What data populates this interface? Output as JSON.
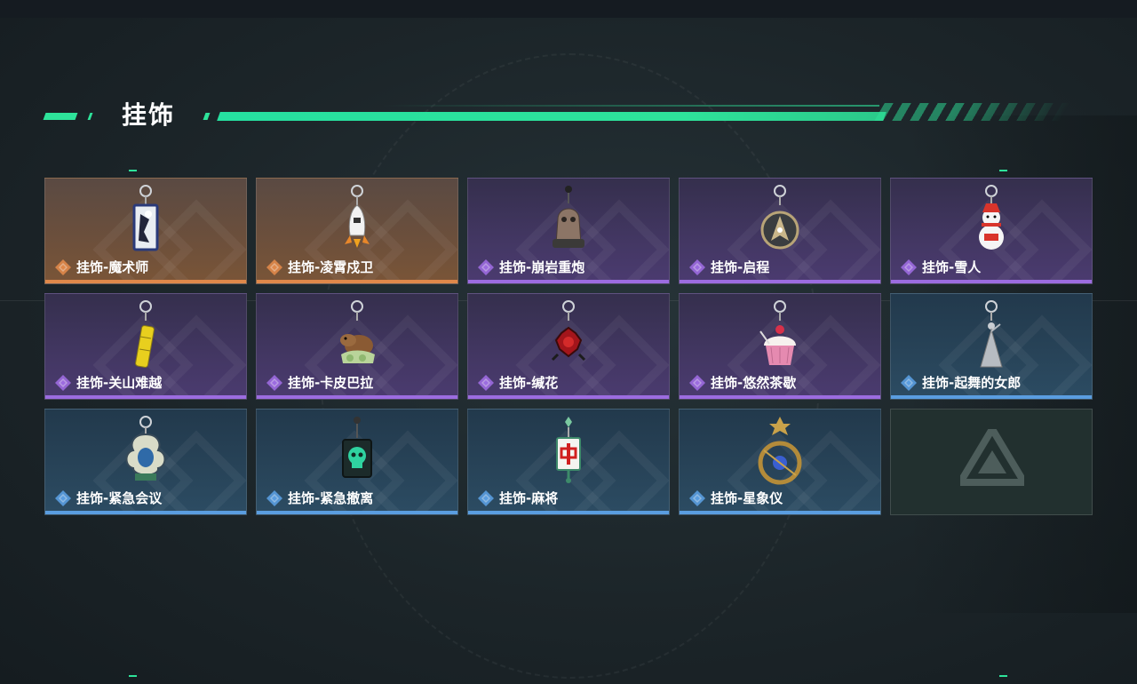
{
  "page": {
    "title": "挂饰"
  },
  "colors": {
    "accent": "#2ee39a",
    "orange": "#e0884a",
    "purple": "#9c6ce0",
    "blue": "#5a9de0"
  },
  "items": [
    {
      "label": "挂饰-魔术师",
      "rarity": "orange",
      "icon": "magician-card-charm-icon"
    },
    {
      "label": "挂饰-凌霄戍卫",
      "rarity": "orange",
      "icon": "rocket-guard-charm-icon"
    },
    {
      "label": "挂饰-崩岩重炮",
      "rarity": "purple",
      "icon": "rock-cannon-charm-icon"
    },
    {
      "label": "挂饰-启程",
      "rarity": "purple",
      "icon": "compass-medal-charm-icon"
    },
    {
      "label": "挂饰-雪人",
      "rarity": "purple",
      "icon": "snowman-charm-icon"
    },
    {
      "label": "挂饰-关山难越",
      "rarity": "purple",
      "icon": "yellow-tube-charm-icon"
    },
    {
      "label": "挂饰-卡皮巴拉",
      "rarity": "purple",
      "icon": "capybara-charm-icon"
    },
    {
      "label": "挂饰-缄花",
      "rarity": "purple",
      "icon": "red-rose-charm-icon"
    },
    {
      "label": "挂饰-悠然茶歇",
      "rarity": "purple",
      "icon": "cupcake-charm-icon"
    },
    {
      "label": "挂饰-起舞的女郎",
      "rarity": "blue",
      "icon": "dancer-figure-charm-icon"
    },
    {
      "label": "挂饰-紧急会议",
      "rarity": "blue",
      "icon": "meeting-badge-charm-icon"
    },
    {
      "label": "挂饰-紧急撤离",
      "rarity": "blue",
      "icon": "green-skull-tag-charm-icon"
    },
    {
      "label": "挂饰-麻将",
      "rarity": "blue",
      "icon": "mahjong-tile-charm-icon"
    },
    {
      "label": "挂饰-星象仪",
      "rarity": "blue",
      "icon": "astrolabe-charm-icon"
    },
    {
      "label": "",
      "rarity": "empty",
      "icon": "game-logo-icon"
    }
  ]
}
